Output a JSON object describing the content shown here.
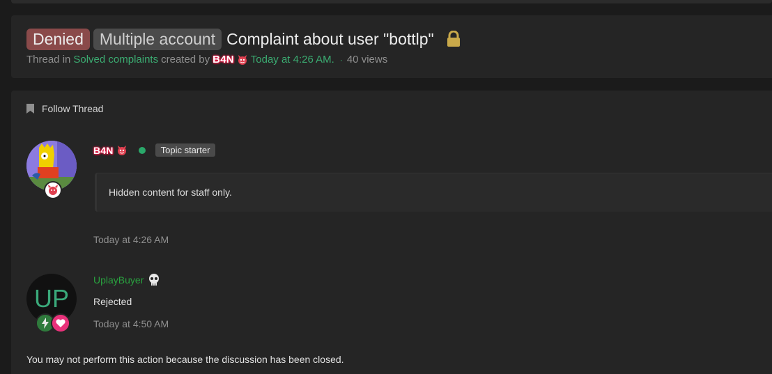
{
  "thread": {
    "prefix_status": "Denied",
    "prefix_type": "Multiple account",
    "title": "Complaint about user \"bottlp\"",
    "meta": {
      "thread_in": "Thread in",
      "forum": "Solved complaints",
      "created_by": "created by",
      "author": "B4N",
      "created_time": "Today at 4:26 AM.",
      "separator": "·",
      "views": "40 views"
    }
  },
  "follow": {
    "label": "Follow Thread"
  },
  "posts": [
    {
      "author": "B4N",
      "badge": "Topic starter",
      "content": "Hidden content for staff only.",
      "date": "Today at 4:26 AM"
    },
    {
      "author": "UplayBuyer",
      "avatar_initials": "UP",
      "content": "Rejected",
      "date": "Today at 4:50 AM"
    }
  ],
  "closed_notice": "You may not perform this action because the discussion has been closed.",
  "colors": {
    "background": "#1b1b1b",
    "panel": "#252525",
    "denied": "#8a4a4a",
    "link": "#3bab71",
    "uplay_name": "#29a33f",
    "online": "#2aa86a",
    "lock": "#c9a94a"
  },
  "icons": [
    "lock-icon",
    "demon-icon",
    "bookmark-icon",
    "skull-icon",
    "bolt-icon",
    "heart-icon"
  ]
}
